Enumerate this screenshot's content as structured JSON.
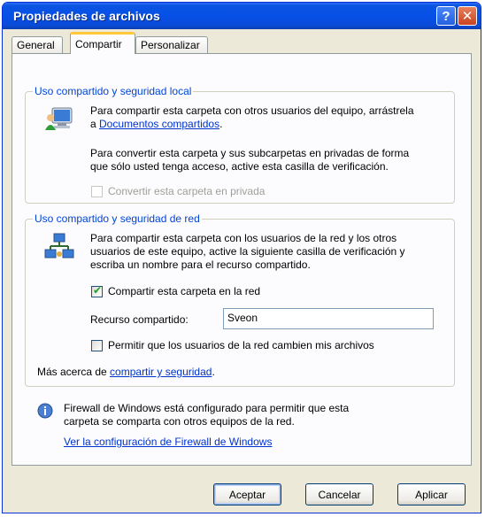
{
  "window": {
    "title": "Propiedades de archivos",
    "help_glyph": "?",
    "close_glyph": "✕"
  },
  "tabs": [
    {
      "label": "General"
    },
    {
      "label": "Compartir"
    },
    {
      "label": "Personalizar"
    }
  ],
  "local": {
    "legend": "Uso compartido y seguridad local",
    "text1": "Para compartir esta carpeta con otros usuarios del equipo, arrástrela",
    "text1b": "a ",
    "link": "Documentos compartidos",
    "text1c": ".",
    "text2a": "Para convertir esta carpeta y sus subcarpetas en privadas de forma",
    "text2b": "que sólo usted tenga acceso, active esta casilla de verificación.",
    "private_checkbox": "Convertir esta carpeta en privada"
  },
  "network": {
    "legend": "Uso compartido y seguridad de red",
    "text1": "Para compartir esta carpeta con los usuarios de la red y los otros",
    "text2": "usuarios de este equipo, active la siguiente casilla de verificación y",
    "text3": "escriba un nombre para el recurso compartido.",
    "share_checkbox": "Compartir esta carpeta en la red",
    "share_checked": true,
    "share_name_label": "Recurso compartido:",
    "share_name_value": "Sveon",
    "allow_checkbox": "Permitir que los usuarios de la red cambien mis archivos",
    "allow_checked": false,
    "more_text": "Más acerca de ",
    "more_link": "compartir y seguridad",
    "more_end": "."
  },
  "firewall": {
    "text1": "Firewall de Windows está configurado para permitir que esta",
    "text2": "carpeta se comparta con otros equipos de la red.",
    "link": "Ver la configuración de Firewall de Windows"
  },
  "buttons": {
    "ok": "Aceptar",
    "cancel": "Cancelar",
    "apply": "Aplicar"
  },
  "colors": {
    "title_bar": "#0650e8",
    "legend": "#0046d5",
    "link": "#0033cc",
    "close": "#c84320"
  }
}
